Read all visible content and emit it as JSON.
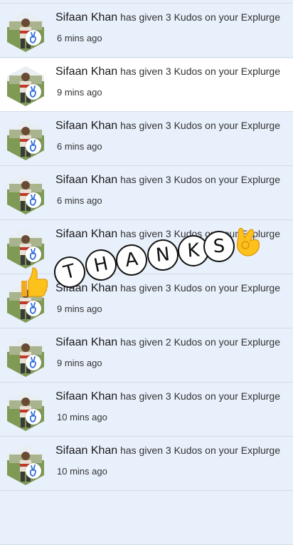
{
  "notifications": [
    {
      "name": "Sifaan Khan",
      "message": "has given 3 Kudos on your Explurge",
      "time": "6 mins ago",
      "read": false
    },
    {
      "name": "Sifaan Khan",
      "message": "has given 3 Kudos on your Explurge",
      "time": "9 mins ago",
      "read": true
    },
    {
      "name": "Sifaan Khan",
      "message": "has given 3 Kudos on your Explurge",
      "time": "6 mins ago",
      "read": false
    },
    {
      "name": "Sifaan Khan",
      "message": "has given 3 Kudos on your Explurge",
      "time": "6 mins ago",
      "read": false
    },
    {
      "name": "Sifaan Khan",
      "message": "has given 3 Kudos on your Explurge",
      "time": "",
      "read": false
    },
    {
      "name": "Sifaan Khan",
      "message": "has given 3 Kudos on your Explurge",
      "time": "9 mins ago",
      "read": false
    },
    {
      "name": "Sifaan Khan",
      "message": "has given 2 Kudos on your Explurge",
      "time": "9 mins ago",
      "read": false
    },
    {
      "name": "Sifaan Khan",
      "message": "has given 3 Kudos on your Explurge",
      "time": "10 mins ago",
      "read": false
    },
    {
      "name": "Sifaan Khan",
      "message": "has given 3 Kudos on your Explurge",
      "time": "10 mins ago",
      "read": false
    }
  ],
  "sticker": {
    "letters": [
      "T",
      "H",
      "A",
      "N",
      "K",
      "S"
    ],
    "icons": [
      "thumbs-up-icon",
      "ok-hand-icon"
    ]
  },
  "colors": {
    "unread_bg": "#e8f0fb",
    "read_bg": "#ffffff",
    "badge_icon": "#2f6fde"
  }
}
